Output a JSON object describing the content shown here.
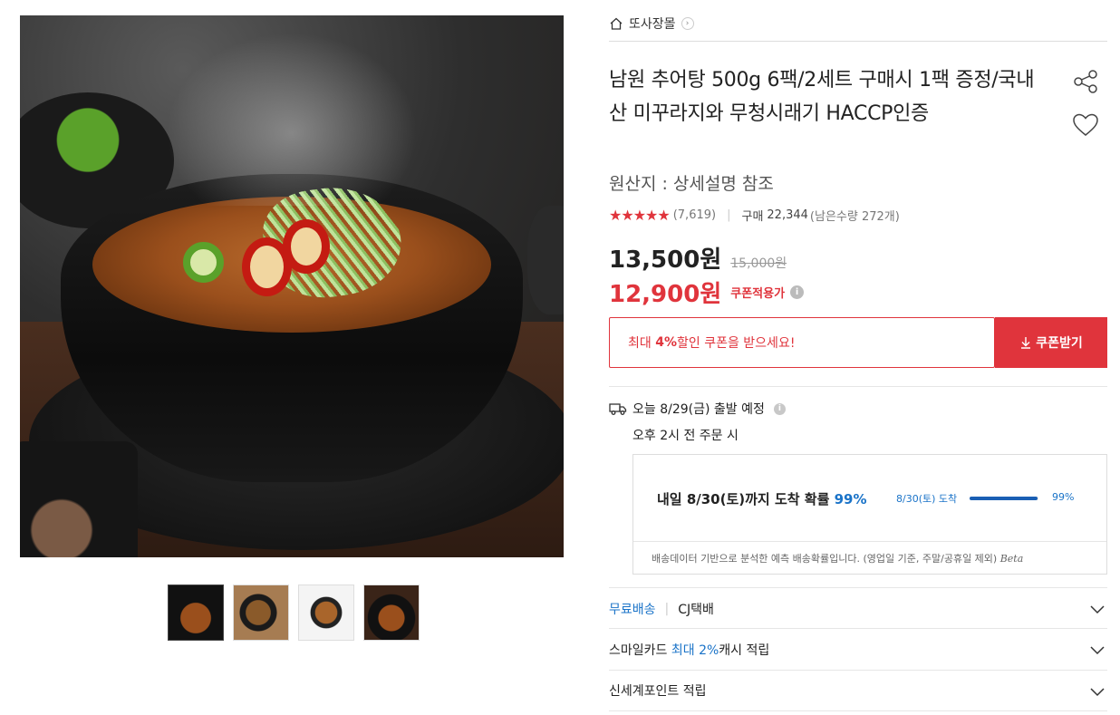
{
  "gallery": {
    "main_image_alt": "남원 추어탕",
    "thumbnails": [
      "thumb-1",
      "thumb-2",
      "thumb-3",
      "thumb-4"
    ]
  },
  "shop": {
    "name": "또사장몰",
    "chevron": "›"
  },
  "product": {
    "title": "남원 추어탕 500g 6팩/2세트 구매시 1팩 증정/국내산 미꾸라지와 무청시래기 HACCP인증",
    "origin": "원산지 : 상세설명 참조",
    "stars": "★★★★★",
    "rating_count": "(7,619)",
    "buy_label": "구매",
    "buy_count": "22,344",
    "remain": "(남은수량 272개)"
  },
  "price": {
    "sale": "13,500원",
    "original": "15,000원",
    "coupon": "12,900원",
    "coupon_label": "쿠폰적용가",
    "info_glyph": "i"
  },
  "coupon": {
    "text_prefix": "최대 ",
    "percent": "4%",
    "text_suffix": " 할인 쿠폰을 받으세요!",
    "button_label": "쿠폰받기"
  },
  "shipping": {
    "departure": "오늘 8/29(금) 출발 예정",
    "info_glyph": "i",
    "cutoff": "오후 2시 전 주문 시",
    "probability": {
      "main_prefix": "내일 8/30(토)까지 도착 확률 ",
      "main_pct": "99%",
      "date_label": "8/30(토) 도착",
      "value": 0.99,
      "pct_label": "99%",
      "note": "배송데이터 기반으로 분석한 예측 배송확률입니다. (영업일 기준, 주말/공휴일 제외)",
      "beta": "Beta"
    }
  },
  "accordion": {
    "free_shipping": "무료배송",
    "carrier": "CJ택배",
    "card_prefix": "스마일카드 ",
    "card_highlight": "최대 2%",
    "card_suffix": " 캐시 적립",
    "points": "신세계포인트 적립"
  },
  "colors": {
    "accent_red": "#e0343c",
    "accent_blue": "#1a73c8"
  }
}
